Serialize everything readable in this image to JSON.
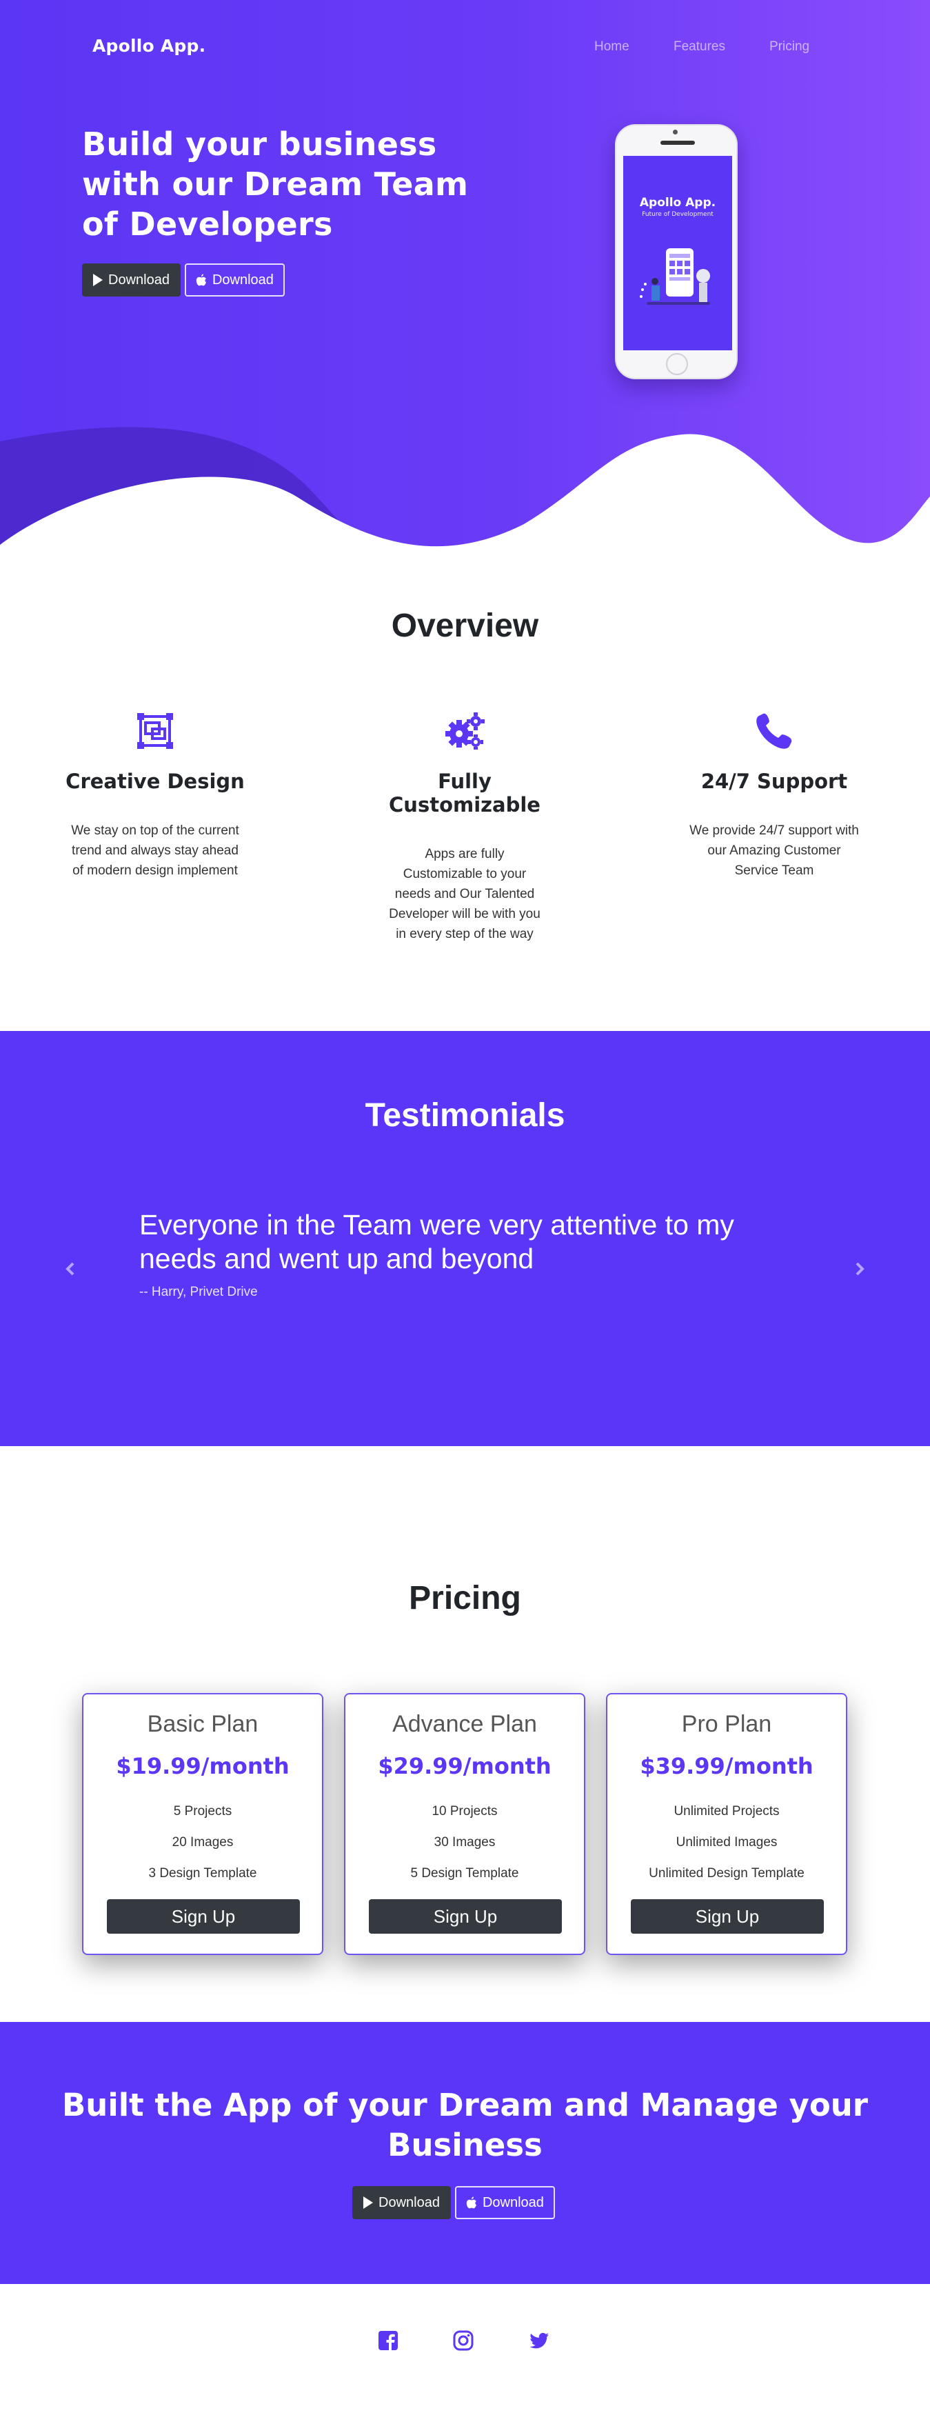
{
  "nav": {
    "brand": "Apollo App.",
    "links": [
      "Home",
      "Features",
      "Pricing"
    ]
  },
  "hero": {
    "title": "Build your business with our Dream Team of Developers",
    "buttons": [
      {
        "label": "Download",
        "icon": "google-play-icon"
      },
      {
        "label": "Download",
        "icon": "apple-icon"
      }
    ],
    "phone": {
      "app_title": "Apollo App.",
      "app_subtitle": "Future of Development"
    }
  },
  "overview": {
    "title": "Overview",
    "features": [
      {
        "icon": "design-icon",
        "title": "Creative Design",
        "text": "We stay on top of the current trend and always stay ahead of modern design implement"
      },
      {
        "icon": "gears-icon",
        "title": "Fully Customizable",
        "text": "Apps are fully Customizable to your needs and Our Talented Developer will be with you in every step of the way"
      },
      {
        "icon": "phone-icon",
        "title": "24/7 Support",
        "text": "We provide 24/7 support with our Amazing Customer Service Team"
      }
    ]
  },
  "testimonials": {
    "title": "Testimonials",
    "quote": "Everyone in the Team were very attentive to my needs and went up and beyond",
    "author": "-- Harry, Privet Drive"
  },
  "pricing": {
    "title": "Pricing",
    "plans": [
      {
        "name": "Basic Plan",
        "price": "$19.99/month",
        "features": [
          "5 Projects",
          "20 Images",
          "3 Design Template"
        ],
        "button": "Sign Up"
      },
      {
        "name": "Advance Plan",
        "price": "$29.99/month",
        "features": [
          "10 Projects",
          "30 Images",
          "5 Design Template"
        ],
        "button": "Sign Up"
      },
      {
        "name": "Pro Plan",
        "price": "$39.99/month",
        "features": [
          "Unlimited Projects",
          "Unlimited Images",
          "Unlimited Design Template"
        ],
        "button": "Sign Up"
      }
    ]
  },
  "cta": {
    "title": "Built the App of your Dream and Manage your Business",
    "buttons": [
      {
        "label": "Download",
        "icon": "google-play-icon"
      },
      {
        "label": "Download",
        "icon": "apple-icon"
      }
    ]
  },
  "footer": {
    "social": [
      "facebook-icon",
      "instagram-icon",
      "twitter-icon"
    ]
  },
  "colors": {
    "primary": "#5b36f9",
    "dark_button": "#343a40",
    "hero_gradient_start": "#5b36f4",
    "hero_gradient_end": "#8a4cfc"
  }
}
